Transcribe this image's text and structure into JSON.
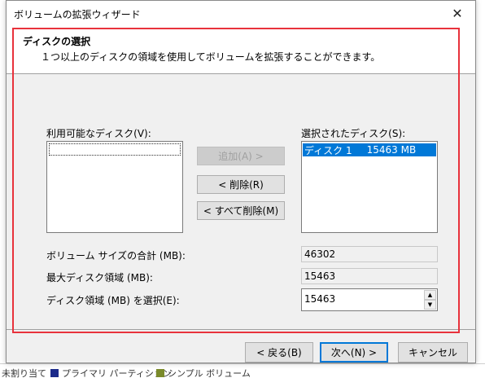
{
  "dialog": {
    "title": "ボリュームの拡張ウィザード",
    "close_glyph": "✕"
  },
  "header": {
    "title": "ディスクの選択",
    "subtitle": "１つ以上のディスクの領域を使用してボリュームを拡張することができます。"
  },
  "available": {
    "label": "利用可能なディスク(V):",
    "items": []
  },
  "selected": {
    "label": "選択されたディスク(S):",
    "items": [
      {
        "name": "ディスク 1",
        "size": "15463 MB"
      }
    ]
  },
  "buttons": {
    "add": "追加(A) >",
    "remove": "< 削除(R)",
    "remove_all": "< すべて削除(M)",
    "back": "< 戻る(B)",
    "next": "次へ(N) >",
    "cancel": "キャンセル"
  },
  "fields": {
    "total_label": "ボリューム サイズの合計 (MB):",
    "total_value": "46302",
    "max_label": "最大ディスク領域 (MB):",
    "max_value": "15463",
    "select_label": "ディスク領域 (MB) を選択(E):",
    "select_value": "15463"
  },
  "background": {
    "legend": [
      {
        "label": "未割り当て",
        "color": "#000000"
      },
      {
        "label": "プライマリ パーティション",
        "color": "#1b2a8a"
      },
      {
        "label": "シンプル ボリューム",
        "color": "#7a8a2a"
      }
    ]
  },
  "colors": {
    "accent": "#0078d7",
    "highlight": "#e8323c"
  }
}
